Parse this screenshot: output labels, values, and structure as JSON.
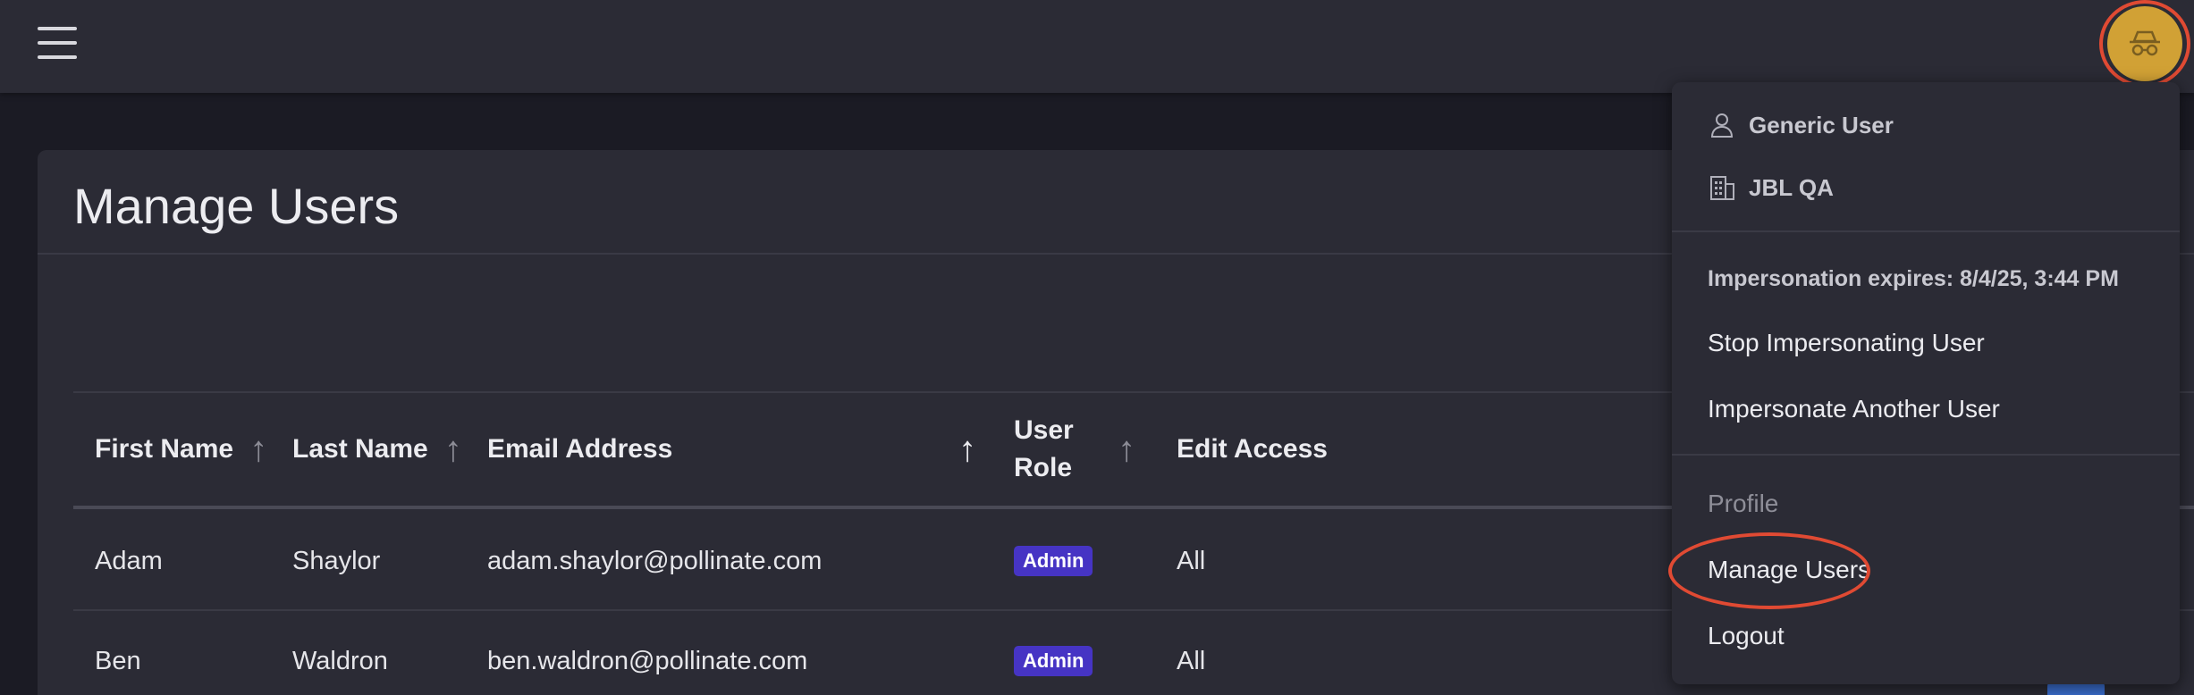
{
  "topbar": {
    "menu_icon": "hamburger-icon",
    "avatar_icon": "incognito-icon"
  },
  "page": {
    "title": "Manage Users"
  },
  "table": {
    "columns": [
      {
        "label": "First Name",
        "sort": "asc"
      },
      {
        "label": "Last Name",
        "sort": "asc"
      },
      {
        "label": "Email Address",
        "sort": "asc"
      },
      {
        "label": "User Role",
        "sort": "asc"
      },
      {
        "label": "Edit Access",
        "sort": "none"
      }
    ],
    "rows": [
      {
        "first": "Adam",
        "last": "Shaylor",
        "email": "adam.shaylor@pollinate.com",
        "role": "Admin",
        "access": "All"
      },
      {
        "first": "Ben",
        "last": "Waldron",
        "email": "ben.waldron@pollinate.com",
        "role": "Admin",
        "access": "All"
      }
    ]
  },
  "dropdown": {
    "user_name": "Generic User",
    "org_name": "JBL QA",
    "impersonation_expires": "Impersonation expires: 8/4/25, 3:44 PM",
    "stop_impersonating": "Stop Impersonating User",
    "impersonate_another": "Impersonate Another User",
    "profile": "Profile",
    "manage_users": "Manage Users",
    "logout": "Logout"
  },
  "colors": {
    "background": "#1b1b24",
    "surface": "#2b2b35",
    "avatar": "#d1a135",
    "highlight": "#e04a33",
    "badge": "#4634c4"
  }
}
